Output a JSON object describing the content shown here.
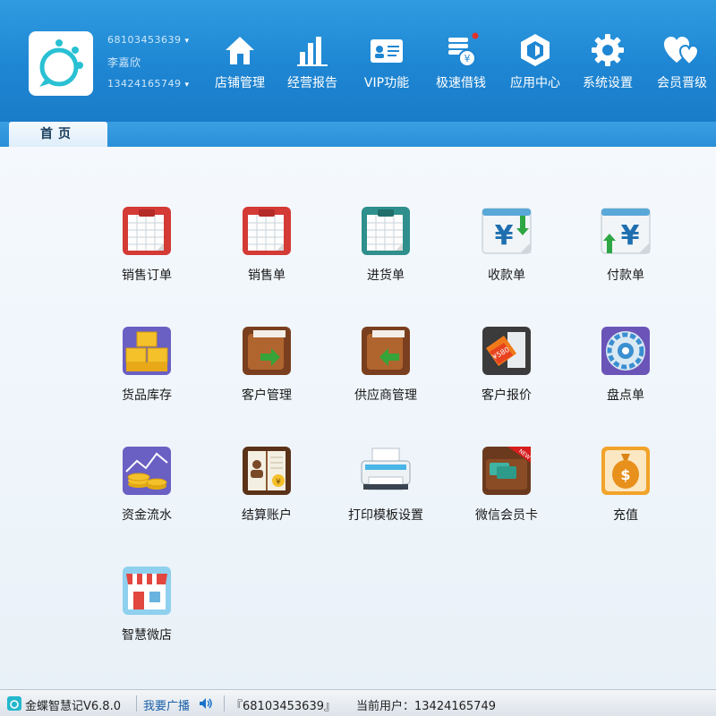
{
  "header": {
    "account_id_masked": "68103453639",
    "user_name": "李嘉欣",
    "phone_masked": "13424165749",
    "nav": [
      {
        "label": "店铺管理",
        "icon": "home-icon"
      },
      {
        "label": "经营报告",
        "icon": "bar-chart-icon"
      },
      {
        "label": "VIP功能",
        "icon": "vip-card-icon"
      },
      {
        "label": "极速借钱",
        "icon": "coin-stack-icon"
      },
      {
        "label": "应用中心",
        "icon": "app-hexagon-icon"
      },
      {
        "label": "系统设置",
        "icon": "gear-icon"
      },
      {
        "label": "会员晋级",
        "icon": "hearts-icon"
      }
    ]
  },
  "tab": {
    "label": "首页"
  },
  "tiles": [
    {
      "label": "销售订单",
      "icon": "red-clipboard-icon"
    },
    {
      "label": "销售单",
      "icon": "red-clipboard-icon"
    },
    {
      "label": "进货单",
      "icon": "teal-clipboard-icon"
    },
    {
      "label": "收款单",
      "icon": "yen-receive-icon"
    },
    {
      "label": "付款单",
      "icon": "yen-pay-icon"
    },
    {
      "label": "货品库存",
      "icon": "boxes-icon"
    },
    {
      "label": "客户管理",
      "icon": "customer-folder-icon"
    },
    {
      "label": "供应商管理",
      "icon": "supplier-folder-icon"
    },
    {
      "label": "客户报价",
      "icon": "price-tag-icon"
    },
    {
      "label": "盘点单",
      "icon": "inventory-disc-icon"
    },
    {
      "label": "资金流水",
      "icon": "coins-chart-icon"
    },
    {
      "label": "结算账户",
      "icon": "ledger-book-icon"
    },
    {
      "label": "打印模板设置",
      "icon": "printer-icon"
    },
    {
      "label": "微信会员卡",
      "icon": "wallet-new-icon"
    },
    {
      "label": "充值",
      "icon": "money-bag-icon"
    },
    {
      "label": "智慧微店",
      "icon": "shop-icon"
    }
  ],
  "status": {
    "app_name": "金蝶智慧记V6.8.0",
    "broadcast": "我要广播",
    "account": "『68103453639』",
    "current_user": "当前用户：13424165749"
  },
  "colors": {
    "header": "#1e86d3",
    "accent": "#2a8fd8"
  }
}
